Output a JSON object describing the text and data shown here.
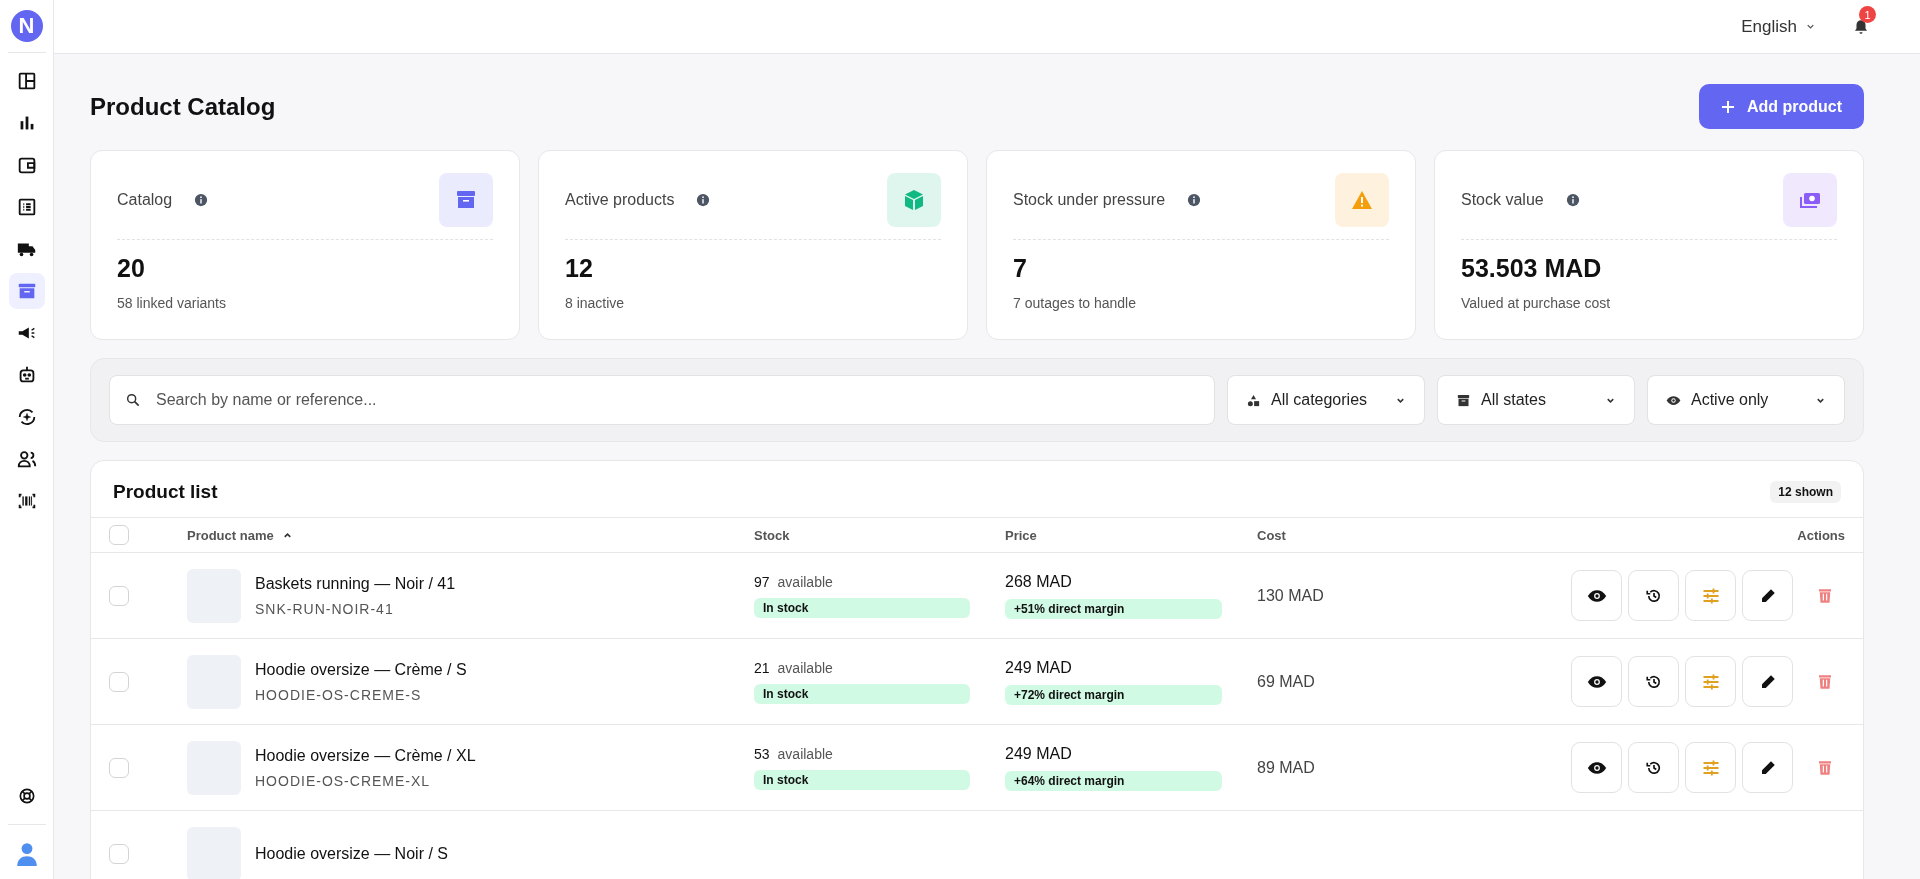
{
  "sidebar": {
    "logo": "N",
    "items": [
      {
        "selected": false
      },
      {
        "selected": false
      },
      {
        "selected": false
      },
      {
        "selected": false
      },
      {
        "selected": false
      },
      {
        "selected": true
      },
      {
        "selected": false
      },
      {
        "selected": false
      },
      {
        "selected": false
      },
      {
        "selected": false
      },
      {
        "selected": false
      }
    ]
  },
  "header": {
    "language": "English",
    "notifications": "1"
  },
  "page": {
    "title": "Product Catalog",
    "add_button": "Add product"
  },
  "stats": [
    {
      "label": "Catalog",
      "value": "20",
      "note": "58 linked variants",
      "color": "#6366f1"
    },
    {
      "label": "Active products",
      "value": "12",
      "note": "8 inactive",
      "color": "#10b981"
    },
    {
      "label": "Stock under pressure",
      "value": "7",
      "note": "7 outages to handle",
      "color": "#f59e0b"
    },
    {
      "label": "Stock value",
      "value": "53.503 MAD",
      "note": "Valued at purchase cost",
      "color": "#8b5cf6"
    }
  ],
  "filters": {
    "search": {
      "placeholder": "Search by name or reference..."
    },
    "dropdowns": [
      "All categories",
      "All states",
      "Active only"
    ]
  },
  "table": {
    "title": "Product list",
    "count": "12 shown",
    "all_checked": false,
    "columns": [
      {
        "label": "Product name",
        "sorted": true
      },
      {
        "label": "Stock",
        "sorted": false
      },
      {
        "label": "Price",
        "sorted": false
      },
      {
        "label": "Cost",
        "sorted": false
      },
      {
        "label": "Actions",
        "sorted": false
      }
    ],
    "rows": [
      {
        "checked": false,
        "name": "Baskets running — Noir / 41",
        "sku": "SNK-RUN-NOIR-41",
        "qty": "97",
        "qty_label": "available",
        "status": "In stock",
        "price": "268 MAD",
        "margin": "+51% direct margin",
        "cost": "130 MAD"
      },
      {
        "checked": false,
        "name": "Hoodie oversize — Crème / S",
        "sku": "HOODIE-OS-CREME-S",
        "qty": "21",
        "qty_label": "available",
        "status": "In stock",
        "price": "249 MAD",
        "margin": "+72% direct margin",
        "cost": "69 MAD"
      },
      {
        "checked": false,
        "name": "Hoodie oversize — Crème / XL",
        "sku": "HOODIE-OS-CREME-XL",
        "qty": "53",
        "qty_label": "available",
        "status": "In stock",
        "price": "249 MAD",
        "margin": "+64% direct margin",
        "cost": "89 MAD"
      },
      {
        "checked": false,
        "name": "Hoodie oversize — Noir / S"
      }
    ]
  }
}
